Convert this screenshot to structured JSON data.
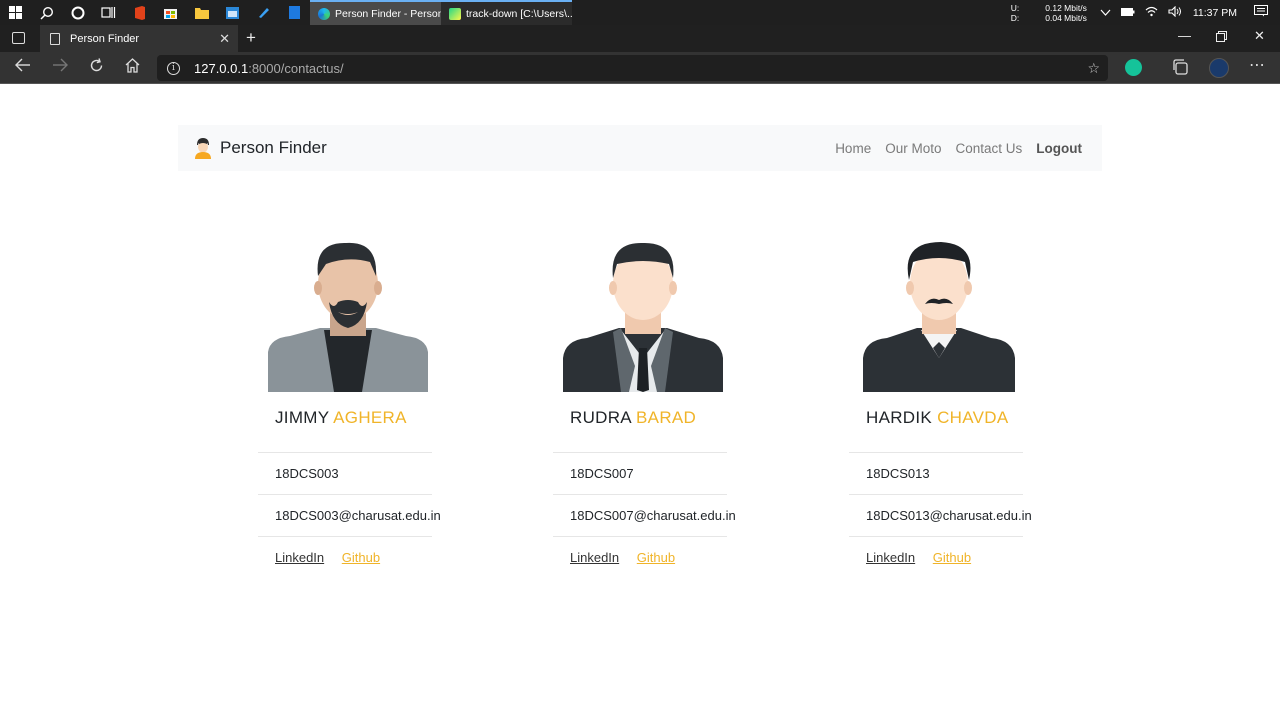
{
  "taskbar": {
    "tasks": [
      {
        "label": "Person Finder - Person...",
        "active": true
      },
      {
        "label": "track-down [C:\\Users\\...",
        "active": false
      }
    ],
    "net_up_label": "U:",
    "net_down_label": "D:",
    "net_up": "0.12 Mbit/s",
    "net_down": "0.04 Mbit/s",
    "time": "11:37 PM"
  },
  "browser": {
    "tab_title": "Person Finder",
    "url_host": "127.0.0.1",
    "url_rest": ":8000/contactus/"
  },
  "navbar": {
    "brand": "Person Finder",
    "links": [
      "Home",
      "Our Moto",
      "Contact Us",
      "Logout"
    ]
  },
  "team": [
    {
      "first": "JIMMY",
      "last": "AGHERA",
      "id": "18DCS003",
      "email": "18DCS003@charusat.edu.in",
      "linkedin": "LinkedIn",
      "github": "Github"
    },
    {
      "first": "RUDRA",
      "last": "BARAD",
      "id": "18DCS007",
      "email": "18DCS007@charusat.edu.in",
      "linkedin": "LinkedIn",
      "github": "Github"
    },
    {
      "first": "HARDIK",
      "last": "CHAVDA",
      "id": "18DCS013",
      "email": "18DCS013@charusat.edu.in",
      "linkedin": "LinkedIn",
      "github": "Github"
    }
  ],
  "colors": {
    "accent": "#f0b429",
    "navbar_bg": "#f8f9fa",
    "text": "#212529"
  }
}
